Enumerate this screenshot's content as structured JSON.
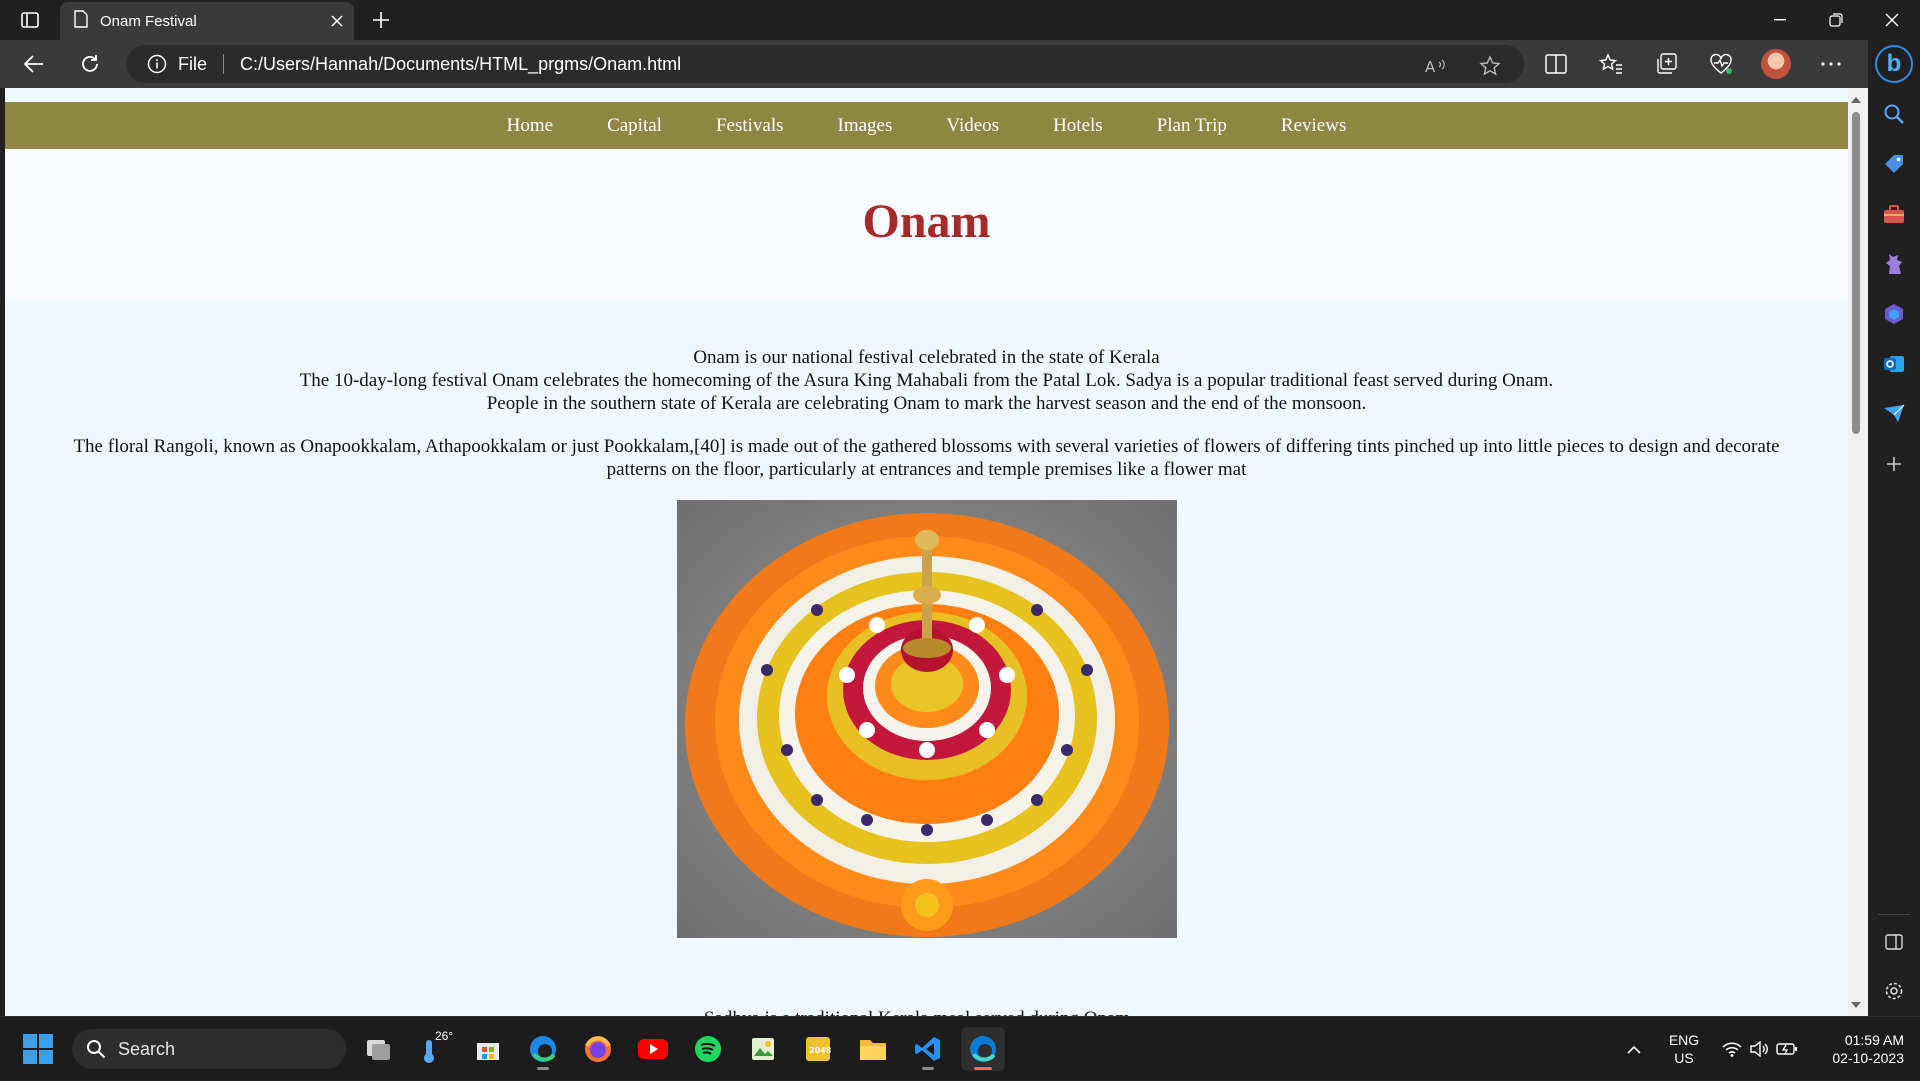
{
  "browser": {
    "tab_title": "Onam Festival",
    "address_scheme": "File",
    "address_url": "C:/Users/Hannah/Documents/HTML_prgms/Onam.html"
  },
  "site": {
    "nav": [
      "Home",
      "Capital",
      "Festivals",
      "Images",
      "Videos",
      "Hotels",
      "Plan Trip",
      "Reviews"
    ],
    "heading": "Onam",
    "intro_lines": [
      "Onam is our national festival celebrated in the state of Kerala",
      "The 10-day-long festival Onam celebrates the homecoming of the Asura King Mahabali from the Patal Lok. Sadya is a popular traditional feast served during Onam.",
      "People in the southern state of Kerala are celebrating Onam to mark the harvest season and the end of the monsoon."
    ],
    "rangoli_paragraph": "The floral Rangoli, known as Onapookkalam, Athapookkalam or just Pookkalam,[40] is made out of the gathered blossoms with several varieties of flowers of differing tints pinched up into little pieces to design and decorate patterns on the floor, particularly at entrances and temple premises like a flower mat"
  },
  "taskbar": {
    "search_placeholder": "Search",
    "weather_temp": "26°",
    "lang_primary": "ENG",
    "lang_region": "US",
    "time": "01:59 AM",
    "date": "02-10-2023"
  },
  "colors": {
    "nav_bg": "#8f8644",
    "heading": "#a52a2a",
    "page_bg": "#f0f8ff"
  }
}
